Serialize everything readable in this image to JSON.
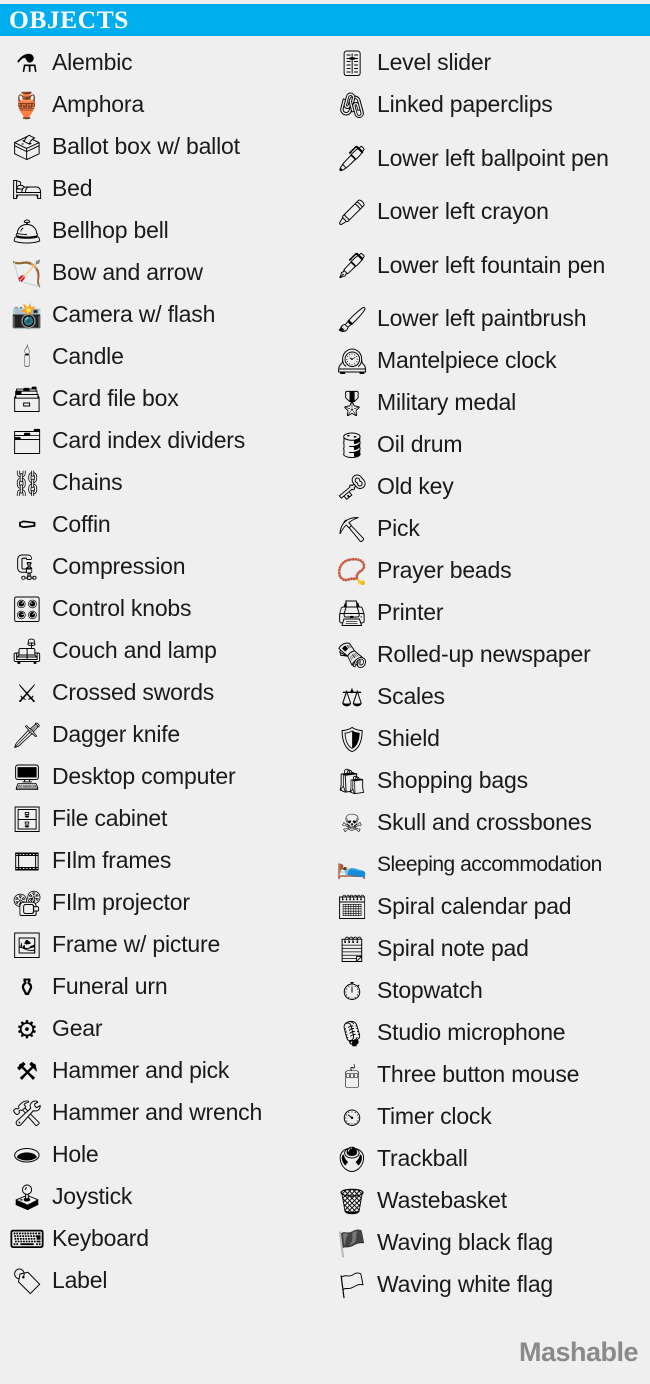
{
  "header": {
    "title": "OBJECTS",
    "bg_color": "#00adef",
    "text_color": "#ffffff"
  },
  "page": {
    "background_color": "#efeff0",
    "text_color": "#1a1a1a"
  },
  "footer": {
    "brand": "Mashable",
    "color": "#8a8a8a"
  },
  "columns": [
    {
      "name": "left-column",
      "items": [
        {
          "icon": "⚗",
          "icon_name": "alembic-icon",
          "label": "Alembic"
        },
        {
          "icon": "🏺",
          "icon_name": "amphora-icon",
          "label": "Amphora"
        },
        {
          "icon": "🗳",
          "icon_name": "ballot-box-icon",
          "label": "Ballot box w/ ballot"
        },
        {
          "icon": "🛏",
          "icon_name": "bed-icon",
          "label": "Bed"
        },
        {
          "icon": "🛎",
          "icon_name": "bellhop-bell-icon",
          "label": "Bellhop bell"
        },
        {
          "icon": "🏹",
          "icon_name": "bow-and-arrow-icon",
          "label": "Bow and arrow"
        },
        {
          "icon": "📸",
          "icon_name": "camera-with-flash-icon",
          "label": "Camera w/ flash"
        },
        {
          "icon": "🕯",
          "icon_name": "candle-icon",
          "label": "Candle"
        },
        {
          "icon": "🗃",
          "icon_name": "card-file-box-icon",
          "label": "Card file box"
        },
        {
          "icon": "🗂",
          "icon_name": "card-index-dividers-icon",
          "label": "Card index dividers"
        },
        {
          "icon": "⛓",
          "icon_name": "chains-icon",
          "label": "Chains"
        },
        {
          "icon": "⚰",
          "icon_name": "coffin-icon",
          "label": "Coffin"
        },
        {
          "icon": "🗜",
          "icon_name": "compression-icon",
          "label": "Compression"
        },
        {
          "icon": "🎛",
          "icon_name": "control-knobs-icon",
          "label": "Control knobs"
        },
        {
          "icon": "🛋",
          "icon_name": "couch-and-lamp-icon",
          "label": "Couch and lamp"
        },
        {
          "icon": "⚔",
          "icon_name": "crossed-swords-icon",
          "label": "Crossed swords"
        },
        {
          "icon": "🗡",
          "icon_name": "dagger-knife-icon",
          "label": "Dagger knife"
        },
        {
          "icon": "🖥",
          "icon_name": "desktop-computer-icon",
          "label": "Desktop computer"
        },
        {
          "icon": "🗄",
          "icon_name": "file-cabinet-icon",
          "label": "File cabinet"
        },
        {
          "icon": "🎞",
          "icon_name": "film-frames-icon",
          "label": "FIlm frames"
        },
        {
          "icon": "📽",
          "icon_name": "film-projector-icon",
          "label": "FIlm projector"
        },
        {
          "icon": "🖼",
          "icon_name": "frame-with-picture-icon",
          "label": "Frame w/ picture"
        },
        {
          "icon": "⚱",
          "icon_name": "funeral-urn-icon",
          "label": "Funeral urn"
        },
        {
          "icon": "⚙",
          "icon_name": "gear-icon",
          "label": "Gear"
        },
        {
          "icon": "⚒",
          "icon_name": "hammer-and-pick-icon",
          "label": "Hammer and pick"
        },
        {
          "icon": "🛠",
          "icon_name": "hammer-and-wrench-icon",
          "label": "Hammer and wrench"
        },
        {
          "icon": "🕳",
          "icon_name": "hole-icon",
          "label": "Hole"
        },
        {
          "icon": "🕹",
          "icon_name": "joystick-icon",
          "label": "Joystick"
        },
        {
          "icon": "⌨",
          "icon_name": "keyboard-icon",
          "label": "Keyboard"
        },
        {
          "icon": "🏷",
          "icon_name": "label-icon",
          "label": "Label"
        }
      ]
    },
    {
      "name": "right-column",
      "items": [
        {
          "icon": "🎚",
          "icon_name": "level-slider-icon",
          "label": "Level slider"
        },
        {
          "icon": "🖇",
          "icon_name": "linked-paperclips-icon",
          "label": "Linked paperclips"
        },
        {
          "icon": "🖊",
          "icon_name": "lower-left-ballpoint-pen-icon",
          "label": "Lower left ballpoint pen",
          "wrap": true
        },
        {
          "icon": "🖍",
          "icon_name": "lower-left-crayon-icon",
          "label": "Lower left crayon"
        },
        {
          "icon": "🖋",
          "icon_name": "lower-left-fountain-pen-icon",
          "label": "Lower left fountain pen",
          "wrap": true
        },
        {
          "icon": "🖌",
          "icon_name": "lower-left-paintbrush-icon",
          "label": "Lower left paintbrush"
        },
        {
          "icon": "🕰",
          "icon_name": "mantelpiece-clock-icon",
          "label": "Mantelpiece clock"
        },
        {
          "icon": "🎖",
          "icon_name": "military-medal-icon",
          "label": "Military medal"
        },
        {
          "icon": "🛢",
          "icon_name": "oil-drum-icon",
          "label": "Oil drum"
        },
        {
          "icon": "🗝",
          "icon_name": "old-key-icon",
          "label": "Old key"
        },
        {
          "icon": "⛏",
          "icon_name": "pick-icon",
          "label": "Pick"
        },
        {
          "icon": "📿",
          "icon_name": "prayer-beads-icon",
          "label": "Prayer beads"
        },
        {
          "icon": "🖨",
          "icon_name": "printer-icon",
          "label": "Printer"
        },
        {
          "icon": "🗞",
          "icon_name": "rolled-up-newspaper-icon",
          "label": "Rolled-up newspaper"
        },
        {
          "icon": "⚖",
          "icon_name": "scales-icon",
          "label": "Scales"
        },
        {
          "icon": "🛡",
          "icon_name": "shield-icon",
          "label": "Shield"
        },
        {
          "icon": "🛍",
          "icon_name": "shopping-bags-icon",
          "label": "Shopping bags"
        },
        {
          "icon": "☠",
          "icon_name": "skull-and-crossbones-icon",
          "label": "Skull and crossbones"
        },
        {
          "icon": "🛌",
          "icon_name": "sleeping-accommodation-icon",
          "label": "Sleeping accommodation",
          "tight": true
        },
        {
          "icon": "🗓",
          "icon_name": "spiral-calendar-pad-icon",
          "label": "Spiral calendar pad"
        },
        {
          "icon": "🗒",
          "icon_name": "spiral-note-pad-icon",
          "label": "Spiral note pad"
        },
        {
          "icon": "⏱",
          "icon_name": "stopwatch-icon",
          "label": "Stopwatch"
        },
        {
          "icon": "🎙",
          "icon_name": "studio-microphone-icon",
          "label": "Studio microphone"
        },
        {
          "icon": "🖱",
          "icon_name": "three-button-mouse-icon",
          "label": "Three button mouse"
        },
        {
          "icon": "⏲",
          "icon_name": "timer-clock-icon",
          "label": "Timer clock"
        },
        {
          "icon": "🖲",
          "icon_name": "trackball-icon",
          "label": "Trackball"
        },
        {
          "icon": "🗑",
          "icon_name": "wastebasket-icon",
          "label": "Wastebasket"
        },
        {
          "icon": "🏴",
          "icon_name": "waving-black-flag-icon",
          "label": "Waving black flag"
        },
        {
          "icon": "🏳",
          "icon_name": "waving-white-flag-icon",
          "label": "Waving white flag"
        }
      ]
    }
  ]
}
